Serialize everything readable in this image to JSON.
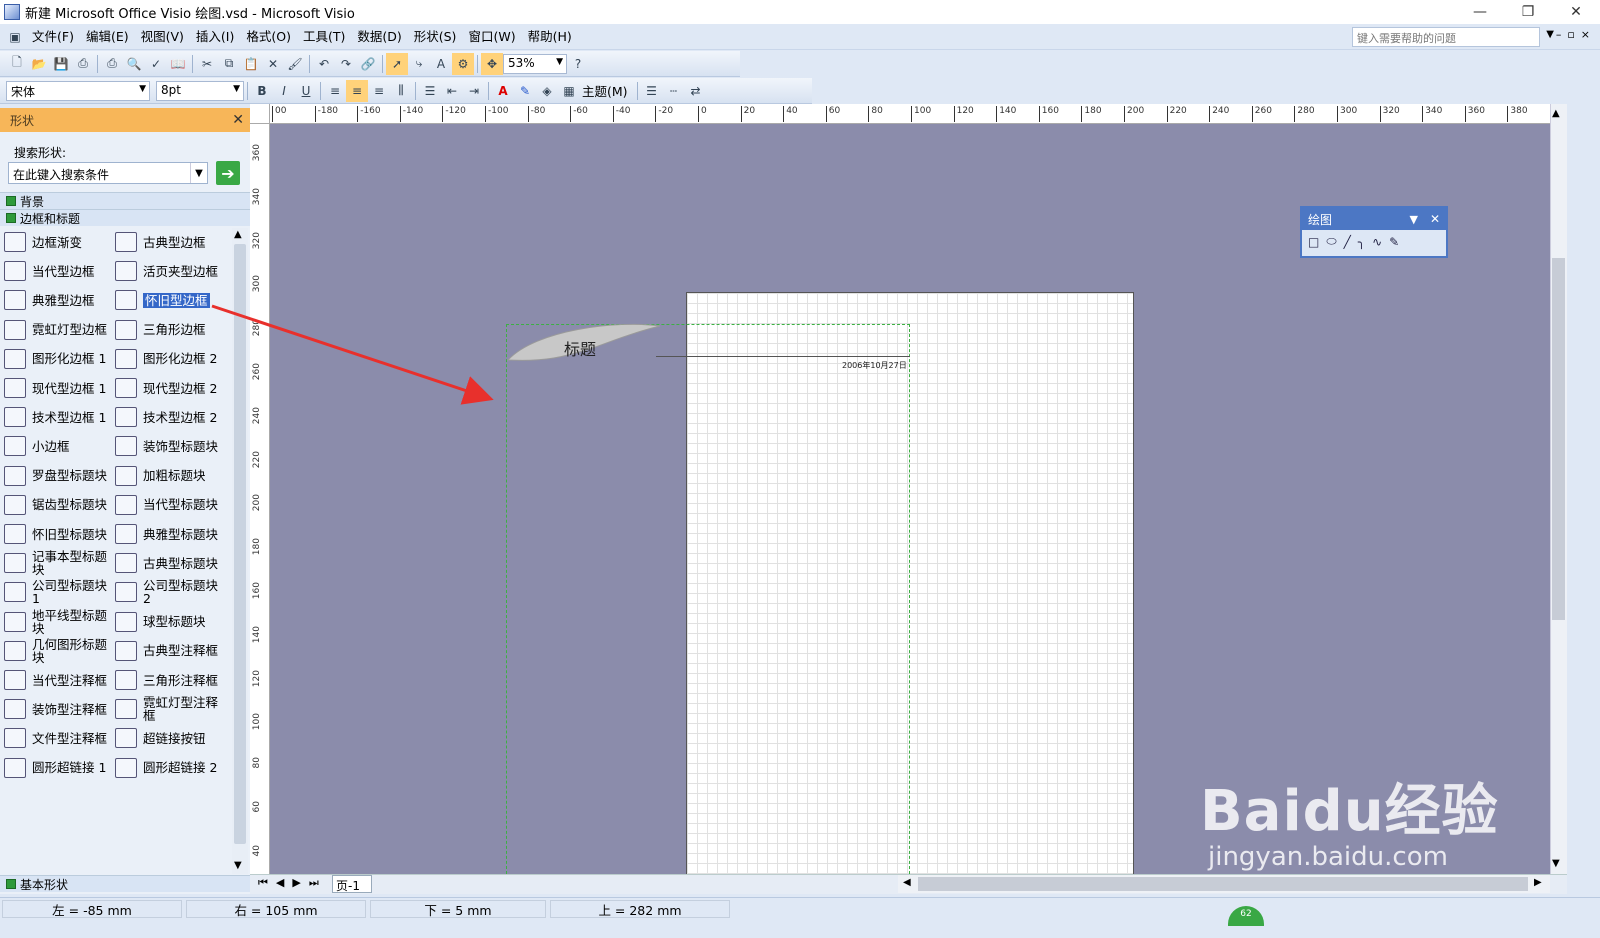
{
  "window": {
    "title": "新建 Microsoft Office Visio 绘图.vsd - Microsoft Visio",
    "minimize": "—",
    "restore": "❐",
    "close": "✕"
  },
  "menu": {
    "items": [
      "文件(F)",
      "编辑(E)",
      "视图(V)",
      "插入(I)",
      "格式(O)",
      "工具(T)",
      "数据(D)",
      "形状(S)",
      "窗口(W)",
      "帮助(H)"
    ],
    "help_placeholder": "键入需要帮助的问题"
  },
  "toolbar": {
    "zoom": "53%",
    "font": "宋体",
    "font_size": "8pt",
    "theme_label": "主题(M)"
  },
  "shapes_panel": {
    "title": "形状",
    "search_label": "搜索形状:",
    "search_placeholder": "在此键入搜索条件",
    "stencils": [
      "背景",
      "边框和标题",
      "基本形状"
    ],
    "items": [
      "边框渐变",
      "古典型边框",
      "当代型边框",
      "活页夹型边框",
      "典雅型边框",
      "怀旧型边框",
      "霓虹灯型边框",
      "三角形边框",
      "图形化边框 1",
      "图形化边框 2",
      "现代型边框 1",
      "现代型边框 2",
      "技术型边框 1",
      "技术型边框 2",
      "小边框",
      "装饰型标题块",
      "罗盘型标题块",
      "加粗标题块",
      "锯齿型标题块",
      "当代型标题块",
      "怀旧型标题块",
      "典雅型标题块",
      "记事本型标题块",
      "古典型标题块",
      "公司型标题块 1",
      "公司型标题块 2",
      "地平线型标题块",
      "球型标题块",
      "几何图形标题块",
      "古典型注释框",
      "当代型注释框",
      "三角形注释框",
      "装饰型注释框",
      "霓虹灯型注释框",
      "文件型注释框",
      "超链接按钮",
      "圆形超链接 1",
      "圆形超链接 2"
    ],
    "selected": "怀旧型边框"
  },
  "ruler": {
    "top": [
      "00",
      "-180",
      "-160",
      "-140",
      "-120",
      "-100",
      "-80",
      "-60",
      "-40",
      "-20",
      "0",
      "20",
      "40",
      "60",
      "80",
      "100",
      "120",
      "140",
      "160",
      "180",
      "200",
      "220",
      "240",
      "260",
      "280",
      "300",
      "320",
      "340",
      "360",
      "380",
      "40"
    ],
    "left": [
      "360",
      "340",
      "320",
      "300",
      "280",
      "260",
      "240",
      "220",
      "200",
      "180",
      "160",
      "140",
      "120",
      "100",
      "80",
      "60",
      "40"
    ]
  },
  "canvas": {
    "title_shape_text": "标题",
    "date_text": "2006年10月27日"
  },
  "drawing_toolbar": {
    "title": "绘图",
    "tools": [
      "□",
      "⬭",
      "╱",
      "╮",
      "∿",
      "✎"
    ]
  },
  "page_tabs": {
    "current": "页-1"
  },
  "status": {
    "left": "左 = -85 mm",
    "right": "右 = 105 mm",
    "bottom": "下 = 5 mm",
    "top": "上 = 282 mm"
  },
  "watermark": {
    "logo": "Baidu经验",
    "url": "jingyan.baidu.com",
    "badge": "62"
  }
}
